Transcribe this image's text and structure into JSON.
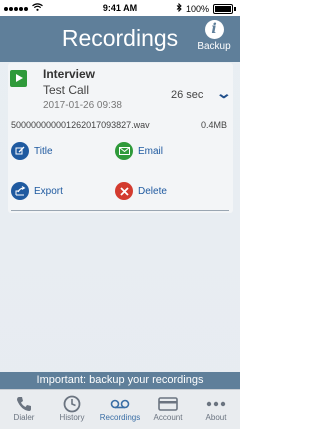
{
  "status": {
    "time": "9:41 AM",
    "battery": "100%"
  },
  "header": {
    "title": "Recordings",
    "backup_label": "Backup",
    "backup_glyph": "i"
  },
  "recording": {
    "name": "Interview",
    "subtitle": "Test Call",
    "datetime": "2017-01-26 09:38",
    "duration": "26 sec",
    "filename": "500000000001262017093827.wav",
    "filesize": "0.4MB"
  },
  "actions": {
    "title": "Title",
    "email": "Email",
    "export": "Export",
    "delete": "Delete"
  },
  "banner": "Important: backup your recordings",
  "tabs": [
    {
      "label": "Dialer",
      "icon": "phone-icon"
    },
    {
      "label": "History",
      "icon": "clock-icon"
    },
    {
      "label": "Recordings",
      "icon": "voicemail-icon"
    },
    {
      "label": "Account",
      "icon": "card-icon"
    },
    {
      "label": "About",
      "icon": "more-icon"
    }
  ],
  "colors": {
    "header": "#5f7f9a",
    "accent": "#1f5aa0",
    "play": "#2f9a3a",
    "email": "#2f9a3a",
    "delete": "#d33b2f",
    "tab_active": "#3a6ea5"
  }
}
